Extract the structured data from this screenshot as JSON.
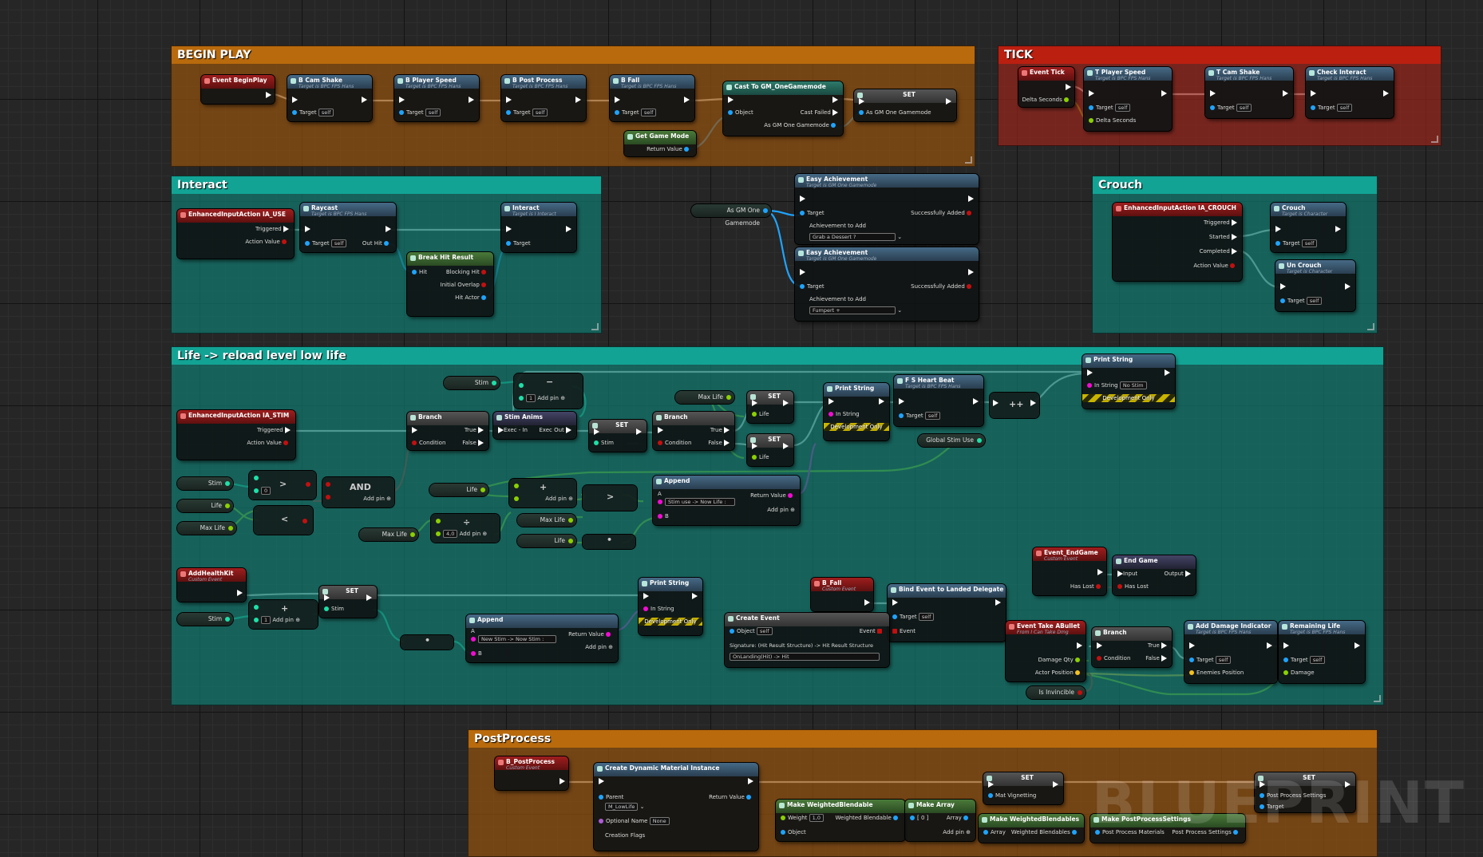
{
  "comments": {
    "begin_play": "BEGIN PLAY",
    "tick": "TICK",
    "interact": "Interact",
    "crouch": "Crouch",
    "life": "Life -> reload level low life",
    "postprocess": "PostProcess"
  },
  "watermark": "BLUEPRINT",
  "labels": {
    "target": "Target",
    "self": "self",
    "add_pin": "Add pin",
    "triggered": "Triggered",
    "action_value": "Action Value",
    "delta_seconds": "Delta Seconds",
    "return_value": "Return Value",
    "object": "Object",
    "cast_failed": "Cast Failed",
    "as_gm": "As GM One Gamemode",
    "set": "SET",
    "true": "True",
    "false": "False",
    "condition": "Condition",
    "in_string": "In String",
    "dev_only": "Development Only",
    "stim": "Stim",
    "life": "Life",
    "max_life": "Max Life",
    "successfully_added": "Successfully Added",
    "achievement_to_add": "Achievement to Add",
    "started": "Started",
    "completed": "Completed",
    "hit": "Hit",
    "blocking_hit": "Blocking Hit",
    "initial_overlap": "Initial Overlap",
    "hit_actor": "Hit Actor",
    "out_hit": "Out Hit",
    "exec_in": "Exec - In",
    "exec_out": "Exec Out",
    "a": "A",
    "b": "B",
    "and": "AND",
    "input": "Input",
    "output": "Output",
    "has_lost": "Has Lost",
    "damage_qty": "Damage Qty",
    "actor_position": "Actor Position",
    "enemies_position": "Enemies Position",
    "damage": "Damage",
    "event": "Event",
    "parent": "Parent",
    "optional_name": "Optional Name",
    "creation_flags": "Creation Flags",
    "none": "None",
    "weight": "Weight",
    "weighted_blendable": "Weighted Blendable",
    "array": "Array",
    "weighted_blendables": "Weighted Blendables",
    "post_process_materials": "Post Process Materials",
    "post_process_settings": "Post Process Settings",
    "mat_vignetting": "Mat Vignetting",
    "zero": "[ 0 ]"
  },
  "nodes": {
    "event_beginplay": "Event BeginPlay",
    "b_cam_shake": "B Cam Shake",
    "b_player_speed": "B Player Speed",
    "b_post_process": "B Post Process",
    "b_fall": "B Fall",
    "target_bpc": "Target is BPC FPS Hans",
    "cast_gm": "Cast To GM_OneGamemode",
    "get_game_mode": "Get Game Mode",
    "event_tick": "Event Tick",
    "t_player_speed": "T Player Speed",
    "t_cam_shake": "T Cam Shake",
    "check_interact": "Check Interact",
    "ia_use": "EnhancedInputAction IA_USE",
    "raycast": "Raycast",
    "interact": "Interact",
    "target_interact": "Target is I Interact",
    "break_hit": "Break Hit Result",
    "easy_ach": "Easy Achievement",
    "target_gm": "Target is GM One Gamemode",
    "ach_value1": "Grab a Dessert ?",
    "ach_value2": "Fumpert +",
    "ia_crouch": "EnhancedInputAction IA_CROUCH",
    "crouch": "Crouch",
    "uncrouch": "Un Crouch",
    "target_char": "Target is Character",
    "ia_stim": "EnhancedInputAction IA_STIM",
    "branch": "Branch",
    "stim_anims": "Stim Anims",
    "print_string": "Print String",
    "fs_heart": "F S Heart Beat",
    "no_stim": "No Stim",
    "global_stim_use": "Global Stim Use",
    "append": "Append",
    "stim_use_str": "Stim use -> Now Life :",
    "add_health": "AddHealthKit",
    "custom_event": "Custom Event",
    "new_stim_str": "New Stim -> Now Stim :",
    "b_fall2": "B_Fall",
    "bind_landed": "Bind Event to Landed Delegate",
    "create_event": "Create Event",
    "signature": "Signature: (Hit Result Structure) -> Hit Result Structure",
    "on_landing": "OnLanding(Hit) -> Hit",
    "event_endgame": "Event_EndGame",
    "end_game": "End Game",
    "take_ability": "Event Take ABullet",
    "take_sub": "From I Can Take Dmg",
    "add_damage": "Add Damage Indicator",
    "remaining_life": "Remaining Life",
    "is_invincible": "Is Invincible",
    "b_postprocess": "B_PostProcess",
    "create_dmi": "Create Dynamic Material Instance",
    "m_lowlife": "M_LowLife",
    "make_wb": "Make WeightedBlendable",
    "make_array": "Make Array",
    "make_wbs": "Make WeightedBlendables",
    "make_pps": "Make PostProcessSettings",
    "weight_val": "1,0",
    "int_val0": "0",
    "int_val1": "1",
    "float_val4": "4,0"
  },
  "colors": {
    "exec": "#ffffff",
    "object": "#1ea4ff",
    "float": "#8bd000",
    "bool": "#c21010",
    "string": "#f20cd2",
    "int": "#1de0a8",
    "vector": "#f4c11e"
  }
}
